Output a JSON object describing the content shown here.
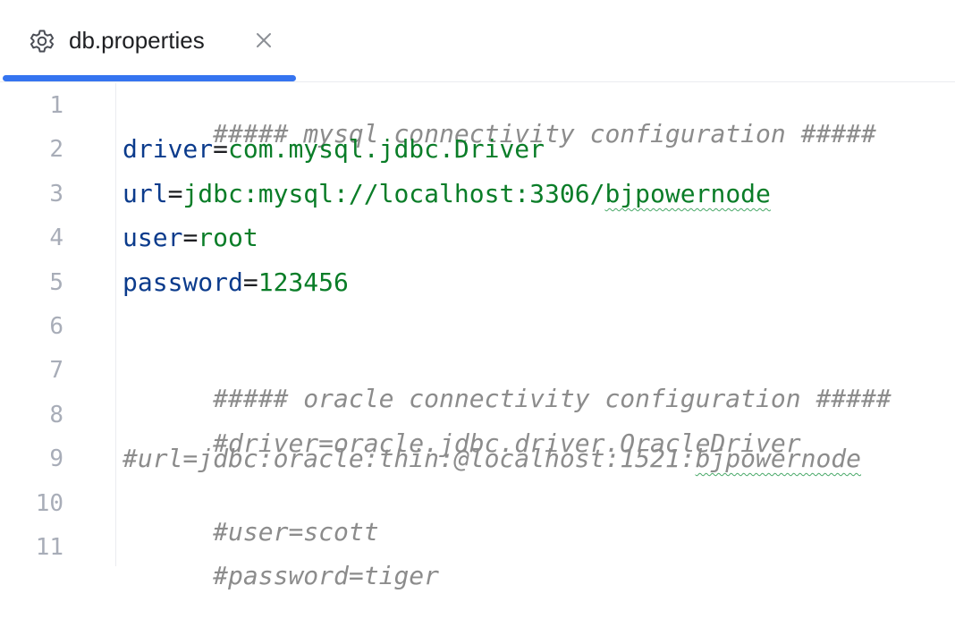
{
  "tab": {
    "filename": "db.properties",
    "icon": "gear-icon",
    "close_icon": "close-icon",
    "accent_color": "#3574f0"
  },
  "lines": [
    {
      "number": "1",
      "kind": "comment",
      "text": "##### mysql connectivity configuration #####"
    },
    {
      "number": "2",
      "kind": "property",
      "key": "driver",
      "eq": "=",
      "value": "com.mysql.jdbc.Driver"
    },
    {
      "number": "3",
      "kind": "property",
      "key": "url",
      "eq": "=",
      "value": "jdbc:mysql://localhost:3306/",
      "value_flagged": "bjpowernode"
    },
    {
      "number": "4",
      "kind": "property",
      "key": "user",
      "eq": "=",
      "value": "root"
    },
    {
      "number": "5",
      "kind": "property",
      "key": "password",
      "eq": "=",
      "value": "123456"
    },
    {
      "number": "6",
      "kind": "blank"
    },
    {
      "number": "7",
      "kind": "comment",
      "text": "##### oracle connectivity configuration #####"
    },
    {
      "number": "8",
      "kind": "comment",
      "text": "#driver=oracle.jdbc.driver.OracleDriver"
    },
    {
      "number": "9",
      "kind": "comment",
      "text": "#url=jdbc:oracle:thin:@localhost:1521:",
      "text_flagged": "bjpowernode"
    },
    {
      "number": "10",
      "kind": "comment",
      "text": "#user=scott"
    },
    {
      "number": "11",
      "kind": "comment",
      "text": "#password=tiger"
    }
  ],
  "colors": {
    "comment": "#8c8c8c",
    "key": "#0b3b8c",
    "value": "#0a7d28",
    "line_number": "#a8adb8",
    "spell_underline": "#48a868"
  }
}
